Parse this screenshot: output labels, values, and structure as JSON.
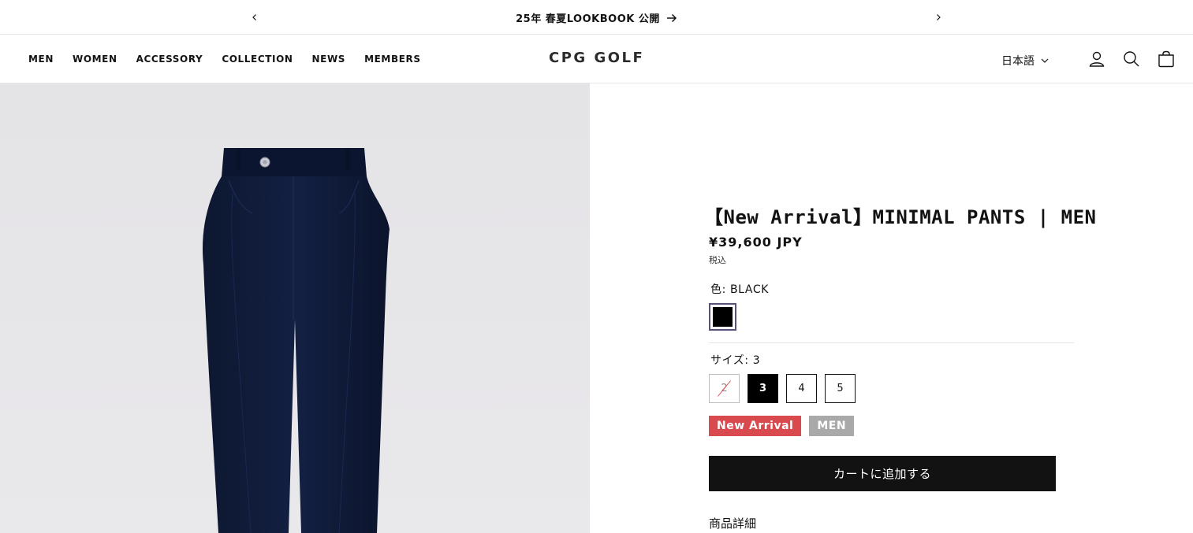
{
  "announcement": {
    "message": "25年 春夏LOOKBOOK 公開",
    "prev_icon": "chevron-left-icon",
    "next_icon": "chevron-right-icon"
  },
  "header": {
    "nav": [
      "MEN",
      "WOMEN",
      "ACCESSORY",
      "COLLECTION",
      "NEWS",
      "MEMBERS"
    ],
    "logo": "CPG GOLF",
    "language": "日本語",
    "icons": [
      "account-icon",
      "search-icon",
      "cart-icon"
    ]
  },
  "product": {
    "title": "【New Arrival】MINIMAL PANTS | MEN",
    "price": "¥39,600 JPY",
    "tax_note": "税込",
    "color_label": "色: BLACK",
    "color_swatch": "#000000",
    "size_label": "サイズ: 3",
    "sizes": [
      {
        "label": "2",
        "state": "soldout"
      },
      {
        "label": "3",
        "state": "selected"
      },
      {
        "label": "4",
        "state": "available"
      },
      {
        "label": "5",
        "state": "available"
      }
    ],
    "badges": [
      {
        "label": "New Arrival",
        "color": "#d94a4f"
      },
      {
        "label": "MEN",
        "color": "#a9a9a9"
      }
    ],
    "add_to_cart": "カートに追加する",
    "details_label": "商品詳細"
  },
  "colors": {
    "text": "#121212",
    "pants": "#101a33",
    "image_bg": "#e6e5e8"
  }
}
